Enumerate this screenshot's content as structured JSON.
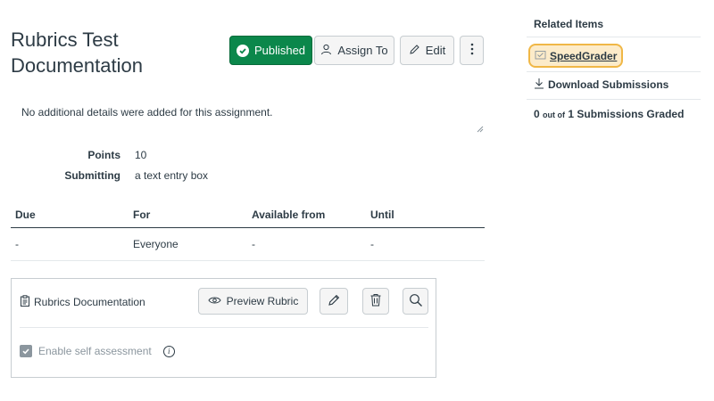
{
  "assignment": {
    "title": "Rubrics Test Documentation",
    "published_label": "Published",
    "assign_to_label": "Assign To",
    "edit_label": "Edit",
    "description": "No additional details were added for this assignment."
  },
  "details": {
    "points_label": "Points",
    "points_value": "10",
    "submitting_label": "Submitting",
    "submitting_value": "a text entry box"
  },
  "dates_table": {
    "headers": [
      "Due",
      "For",
      "Available from",
      "Until"
    ],
    "rows": [
      [
        "-",
        "Everyone",
        "-",
        "-"
      ]
    ]
  },
  "rubric": {
    "title": "Rubrics Documentation",
    "preview_label": "Preview Rubric",
    "self_assessment_label": "Enable self assessment",
    "self_assessment_checked": true
  },
  "sidebar": {
    "heading": "Related Items",
    "speedgrader_label": "SpeedGrader",
    "download_label": "Download Submissions",
    "graded_count": "0",
    "graded_of_text": "out of",
    "graded_total": "1",
    "graded_suffix": "Submissions Graded"
  },
  "colors": {
    "published_green": "#0b874b",
    "text": "#2d3b45",
    "highlight_border": "#f0b746",
    "highlight_fill": "#fcebc9"
  }
}
